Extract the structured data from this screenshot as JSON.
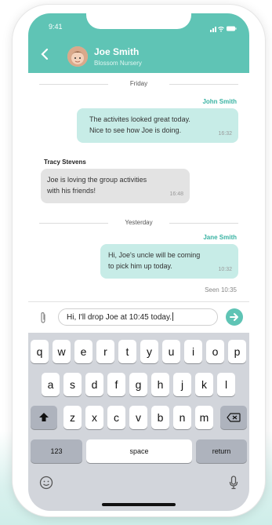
{
  "status_bar": {
    "time": "9:41"
  },
  "header": {
    "name": "Joe Smith",
    "subtitle": "Blossom Nursery"
  },
  "conversation": {
    "day_friday": "Friday",
    "msg1": {
      "sender": "John Smith",
      "text_line1": "The activites looked great today.",
      "text_line2": "Nice to see how Joe is doing.",
      "time": "16:32"
    },
    "msg2": {
      "sender": "Tracy Stevens",
      "text_line1": "Joe is loving the group activities",
      "text_line2": "with his friends!",
      "time": "16:48"
    },
    "day_yesterday": "Yesterday",
    "msg3": {
      "sender": "Jane Smith",
      "text_line1": "Hi, Joe's uncle will be coming",
      "text_line2": "to pick him up today.",
      "time": "10:32"
    },
    "seen": "Seen 10:35"
  },
  "composer": {
    "text": "Hi, I'll drop Joe at 10:45 today."
  },
  "keyboard": {
    "row1": [
      "q",
      "w",
      "e",
      "r",
      "t",
      "y",
      "u",
      "i",
      "o",
      "p"
    ],
    "row2": [
      "a",
      "s",
      "d",
      "f",
      "g",
      "h",
      "j",
      "k",
      "l"
    ],
    "row3": [
      "z",
      "x",
      "c",
      "v",
      "b",
      "n",
      "m"
    ],
    "numbers_label": "123",
    "space_label": "space",
    "return_label": "return"
  },
  "colors": {
    "accent": "#5fc4b5",
    "outgoing_bubble": "#c7ece7",
    "incoming_bubble": "#e3e3e3"
  },
  "icons": [
    "back-chevron-icon",
    "signal-icon",
    "wifi-icon",
    "battery-icon",
    "paperclip-icon",
    "send-icon",
    "shift-icon",
    "backspace-icon",
    "emoji-icon",
    "microphone-icon"
  ]
}
